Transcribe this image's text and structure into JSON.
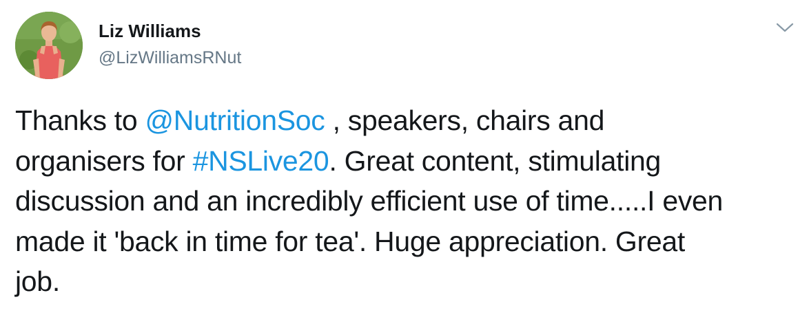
{
  "author": {
    "name": "Liz Williams",
    "handle": "@LizWilliamsRNut"
  },
  "icons": {
    "avatar": "profile-photo",
    "menu": "chevron-down-icon"
  },
  "colors": {
    "link": "#1b95e0",
    "handle": "#657786",
    "text": "#14171a"
  },
  "tweet": {
    "line1_pre": "Thanks to ",
    "mention": "@NutritionSoc",
    "line1_post": " , speakers, chairs and",
    "line2_pre": "organisers for ",
    "hashtag": "#NSLive20",
    "line2_post": ". Great content, stimulating",
    "line3": "discussion and an incredibly efficient use of time.....I even",
    "line4": "made it 'back in time for tea'. Huge appreciation. Great",
    "line5": "job."
  }
}
